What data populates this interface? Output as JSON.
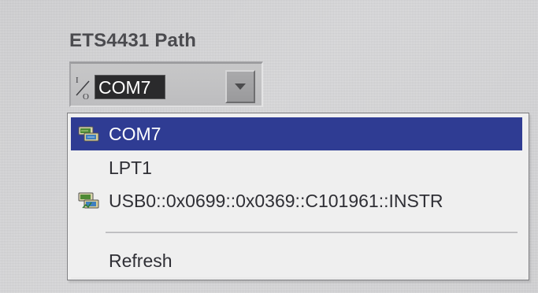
{
  "control": {
    "label": "ETS4431 Path",
    "current_value": "COM7",
    "icon_name": "io-icon"
  },
  "dropdown": {
    "button_icon": "chevron-down-icon",
    "items": [
      {
        "label": "COM7",
        "icon_name": "serial-port-icon",
        "selected": true
      },
      {
        "label": "LPT1",
        "icon_name": "",
        "selected": false
      },
      {
        "label": "USB0::0x0699::0x0369::C101961::INSTR",
        "icon_name": "usb-instrument-icon",
        "selected": false
      },
      {
        "label": "Refresh",
        "icon_name": "",
        "selected": false
      }
    ]
  },
  "colors": {
    "selection_bg": "#2f3c93",
    "menu_text": "#2f2f35",
    "label_text": "#4b4b4f",
    "path_value_bg": "#2a2a2c"
  }
}
